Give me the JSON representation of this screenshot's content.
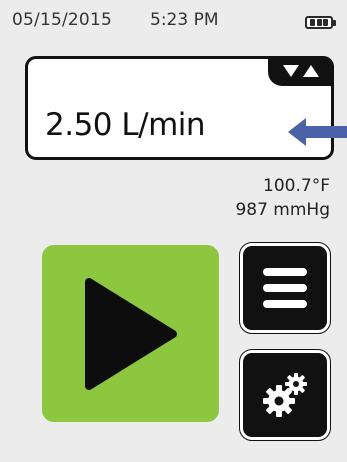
{
  "status": {
    "date": "05/15/2015",
    "time": "5:23 PM",
    "battery_icon": "battery-full-icon"
  },
  "flow": {
    "value": "2.50 L/min",
    "adjust_icons": [
      "triangle-down-icon",
      "triangle-up-icon"
    ]
  },
  "readings": {
    "temperature": "100.7°F",
    "pressure": "987 mmHg"
  },
  "controls": {
    "play_icon": "play-icon",
    "menu_icon": "menu-icon",
    "settings_icon": "gears-icon"
  },
  "colors": {
    "background": "#ececec",
    "play_green": "#8dc63f",
    "button_dark": "#111111",
    "arrow_blue": "#4a63a8"
  }
}
